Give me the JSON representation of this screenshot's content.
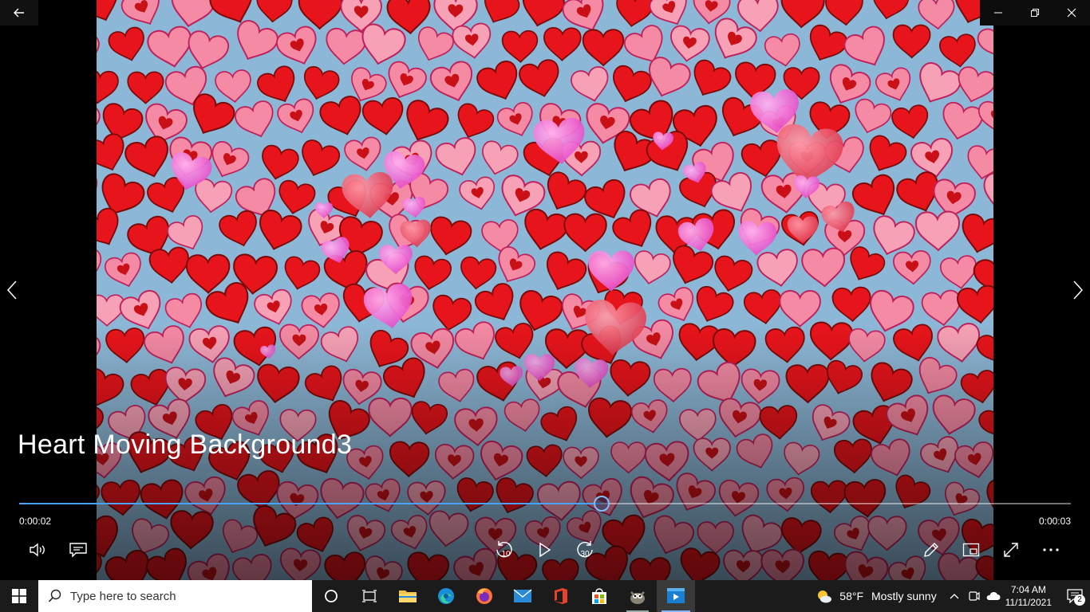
{
  "video": {
    "title": "Heart Moving Background3",
    "current_time": "0:00:02",
    "total_time": "0:00:03",
    "progress": 0.553
  },
  "controls": {
    "skip_back_seconds": "10",
    "skip_forward_seconds": "30"
  },
  "icons": {
    "back": "back-arrow-icon",
    "minimize": "minimize-icon",
    "restore": "restore-icon",
    "close": "close-icon",
    "previous": "chevron-left-icon",
    "next": "chevron-right-icon",
    "volume": "volume-icon",
    "captions": "captions-icon",
    "play": "play-icon",
    "edit": "pencil-icon",
    "mini_view": "mini-view-icon",
    "fullscreen": "fullscreen-icon",
    "more": "more-icon"
  },
  "taskbar": {
    "search_placeholder": "Type here to search",
    "weather_temp": "58°F",
    "weather_condition": "Mostly sunny",
    "time": "7:04 AM",
    "date": "11/11/2021",
    "notification_count": "2"
  },
  "colors": {
    "accent": "#4aa3ff",
    "taskbar_bg": "#1b1b1b",
    "heart_red": "#e8141b",
    "heart_pink": "#f48aa4",
    "bubble_magenta": "#f06ad8",
    "background_blue": "#8db7d6"
  }
}
